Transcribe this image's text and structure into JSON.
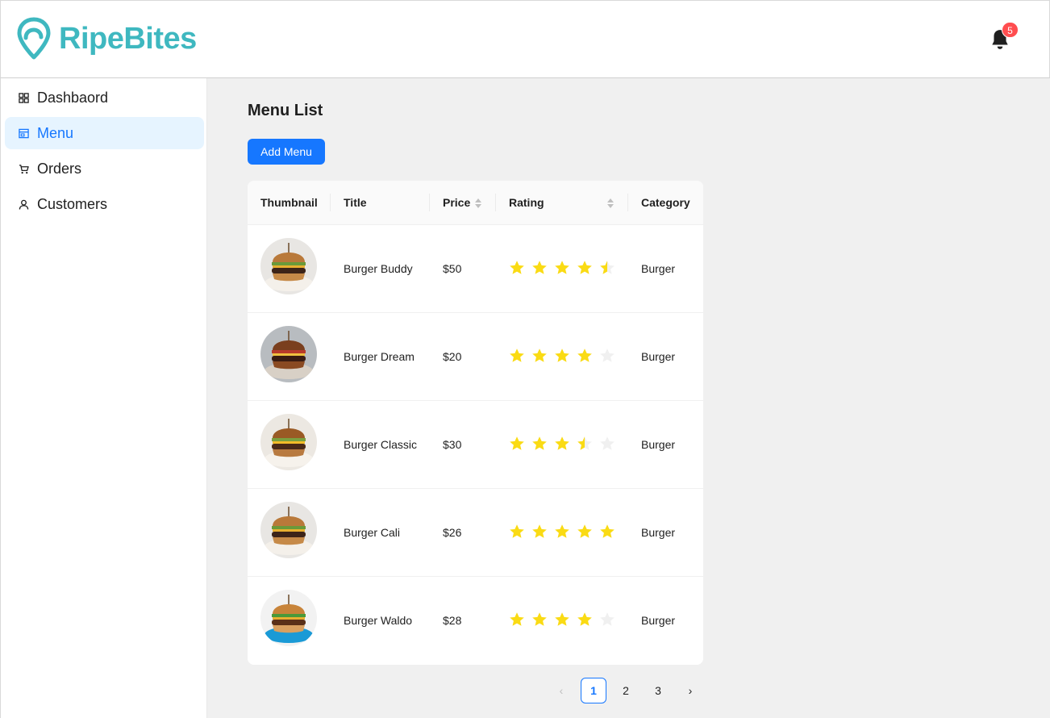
{
  "header": {
    "brand": "RipeBites",
    "brand_color": "#3fb8c0",
    "notification_count": "5"
  },
  "sidebar": {
    "items": [
      {
        "label": "Dashbaord",
        "icon": "grid-icon",
        "active": false
      },
      {
        "label": "Menu",
        "icon": "shop-icon",
        "active": true
      },
      {
        "label": "Orders",
        "icon": "cart-icon",
        "active": false
      },
      {
        "label": "Customers",
        "icon": "user-icon",
        "active": false
      }
    ]
  },
  "main": {
    "title": "Menu List",
    "add_button": "Add Menu",
    "table": {
      "columns": [
        "Thumbnail",
        "Title",
        "Price",
        "Rating",
        "Category"
      ],
      "rows": [
        {
          "title": "Burger Buddy",
          "price": "$50",
          "rating": 4.5,
          "category": "Burger"
        },
        {
          "title": "Burger Dream",
          "price": "$20",
          "rating": 4,
          "category": "Burger"
        },
        {
          "title": "Burger Classic",
          "price": "$30",
          "rating": 3.5,
          "category": "Burger"
        },
        {
          "title": "Burger Cali",
          "price": "$26",
          "rating": 5,
          "category": "Burger"
        },
        {
          "title": "Burger Waldo",
          "price": "$28",
          "rating": 4,
          "category": "Burger"
        }
      ]
    },
    "pagination": {
      "pages": [
        "1",
        "2",
        "3"
      ],
      "current": "1",
      "prev": "‹",
      "next": "›"
    }
  },
  "colors": {
    "primary": "#1677ff",
    "star": "#fadb14",
    "star_empty": "#f0f0f0",
    "badge": "#ff4d4f"
  }
}
